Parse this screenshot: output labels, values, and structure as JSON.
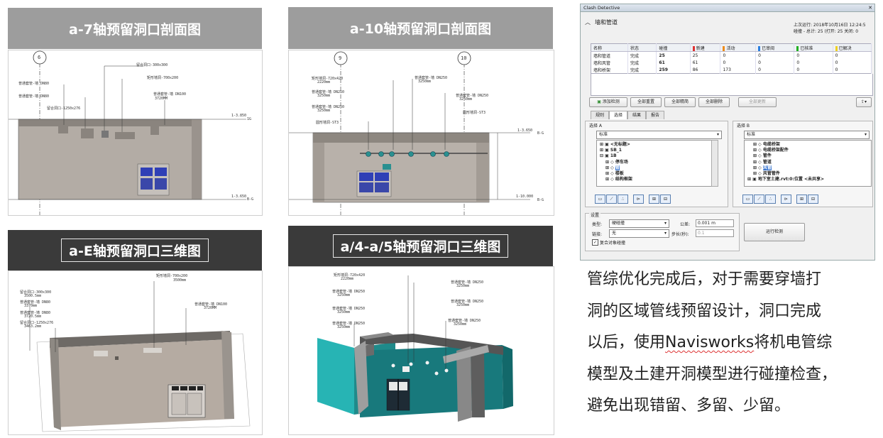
{
  "panels": {
    "p1": {
      "title": "a-7轴预留洞口剖面图",
      "grid_label": "6",
      "annotations": [
        "留合洞口-300x300",
        "矩形墙洞-700x200",
        "普通套管-墙 DN80",
        "普通套管-墙 DN100",
        "普通套管-墙 DN80",
        "3720MM",
        "留合洞口-1250x276"
      ],
      "levels": [
        "1-3.850",
        "1G",
        "1-3.650",
        "B-G"
      ]
    },
    "p2": {
      "title": "a-10轴预留洞口剖面图",
      "grid_labels": [
        "9",
        "10"
      ],
      "annotations": [
        "矩形墙洞-720x420",
        "2220mm",
        "普通套管-墙 DN250",
        "3250mm",
        "普通套管-墙 DN250",
        "3250mm",
        "普通套管-墙 DN250",
        "3250mm",
        "普通套管-墙 DN250",
        "3250mm",
        "圆形墙洞-ST3",
        "圆形墙洞-ST3"
      ],
      "levels": [
        "1-3.650",
        "B-G",
        "1-10.000",
        "B-G"
      ]
    },
    "p3": {
      "title": "a-E轴预留洞口三维图",
      "annotations": [
        "矩形墙洞-700x200",
        "3500mm",
        "留合洞口-300x300",
        "3500.5mm",
        "普通套管-墙 DN80",
        "3370mm",
        "普通套管-墙 DN80",
        "3720.5mm",
        "留合洞口-1250x276",
        "3463.2mm",
        "普通套管-墙 DN100",
        "3720MM"
      ]
    },
    "p4": {
      "title": "a/4-a/5轴预留洞口三维图",
      "annotations": [
        "矩形墙洞-720x420",
        "2220mm",
        "普通套管-墙 DN250",
        "3250mm",
        "普通套管-墙 DN250",
        "3250mm",
        "普通套管-墙 DN250",
        "3250mm",
        "普通套管-墙 DN250",
        "3250mm",
        "普通套管-墙 DN250",
        "3250mm",
        "普通套管-墙 DN250",
        "3250mm"
      ]
    }
  },
  "clash": {
    "window_title": "Clash Detective",
    "section_title": "墙和管道",
    "last_run": "上次运行: 2018年10月16日 12:24:5",
    "summary": "碰撞 - 总计: 25 (打开: 25  关闭: 0",
    "columns": [
      "名称",
      "状态",
      "碰撞",
      "新建",
      "活动",
      "已审阅",
      "已核准",
      "已解决"
    ],
    "col_colors": [
      "",
      "",
      "",
      "#e03030",
      "#f08c1a",
      "#2a7fe0",
      "#22b022",
      "#f0d020"
    ],
    "rows": [
      [
        "墙和管道",
        "完成",
        "25",
        "25",
        "0",
        "0",
        "0",
        "0"
      ],
      [
        "墙和风管",
        "完成",
        "61",
        "61",
        "0",
        "0",
        "0",
        "0"
      ],
      [
        "墙和桥架",
        "完成",
        "259",
        "86",
        "173",
        "0",
        "0",
        "0"
      ]
    ],
    "buttons": {
      "add": "添加检测",
      "reset": "全部重置",
      "compact": "全部精简",
      "delete": "全部删除",
      "refresh": "全部更新"
    },
    "tabs": [
      "规则",
      "选择",
      "结果",
      "报告"
    ],
    "selA": {
      "label": "选择 A",
      "dropdown": "标准",
      "tree": [
        "<无标题>",
        "SB_1",
        "1B",
        "停车场",
        "管",
        "楼板",
        "结构框架"
      ]
    },
    "selB": {
      "label": "选择 B",
      "dropdown": "标准",
      "tree": [
        "电缆桥架",
        "电缆桥架配件",
        "管件",
        "管道",
        "风管",
        "风管管件",
        "地下室土建.rvt:0:位置 <未共享>"
      ]
    },
    "settings": {
      "label": "设置",
      "type_label": "类型:",
      "type_value": "硬碰撞",
      "tol_label": "公差:",
      "tol_value": "0.001 m",
      "link_label": "链接:",
      "link_value": "无",
      "step_label": "步长(秒):",
      "step_value": "0.1",
      "composite": "复合对象碰撞",
      "run": "运行检测"
    }
  },
  "description": {
    "line1": "管综优化完成后，对于需要穿墙打",
    "line2": "洞的区域管线预留设计，洞口完成",
    "line3a": "以后，使用",
    "line3b": "Navisworks",
    "line3c": "将机电管综",
    "line4": "模型及土建开洞模型进行碰撞检查，",
    "line5": "避免出现错留、多留、少留。"
  }
}
